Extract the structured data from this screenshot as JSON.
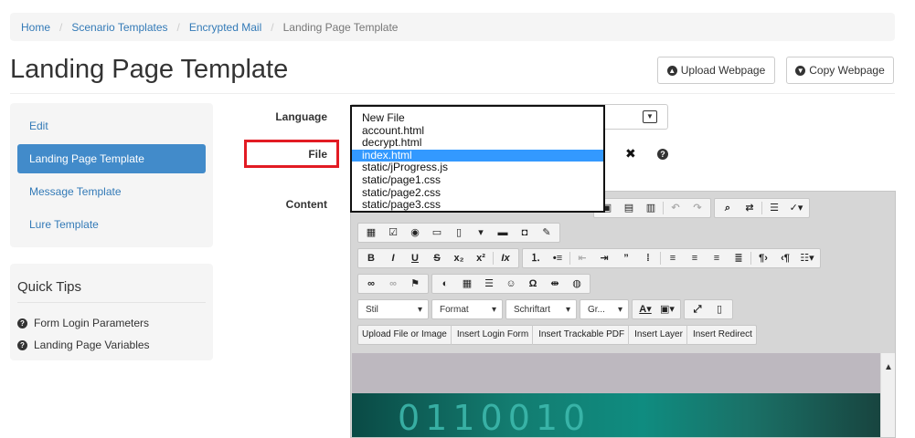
{
  "breadcrumb": {
    "items": [
      "Home",
      "Scenario Templates",
      "Encrypted Mail"
    ],
    "current": "Landing Page Template"
  },
  "page": {
    "title": "Landing Page Template",
    "upload_button": "Upload Webpage",
    "copy_button": "Copy Webpage"
  },
  "sidebar": {
    "items": [
      "Edit",
      "Landing Page Template",
      "Message Template",
      "Lure Template"
    ],
    "active_index": 1
  },
  "tips": {
    "title": "Quick Tips",
    "items": [
      "Form Login Parameters",
      "Landing Page Variables"
    ]
  },
  "form": {
    "language_label": "Language",
    "file_label": "File",
    "content_label": "Content"
  },
  "file_dropdown": {
    "options": [
      "New File",
      "account.html",
      "decrypt.html",
      "index.html",
      "static/jProgress.js",
      "static/page1.css",
      "static/page2.css",
      "static/page3.css"
    ],
    "selected_index": 3
  },
  "editor": {
    "combos": [
      "Stil",
      "Format",
      "Schriftart",
      "Gr..."
    ],
    "custom_buttons": [
      "Upload File or Image",
      "Insert Login Form",
      "Insert Trackable PDF",
      "Insert Layer",
      "Insert Redirect"
    ],
    "banner_text": "0110010"
  },
  "colors": {
    "link": "#337ab7",
    "active_nav": "#428bca",
    "highlight_box": "#e21b23",
    "dropdown_selected": "#3399ff"
  }
}
